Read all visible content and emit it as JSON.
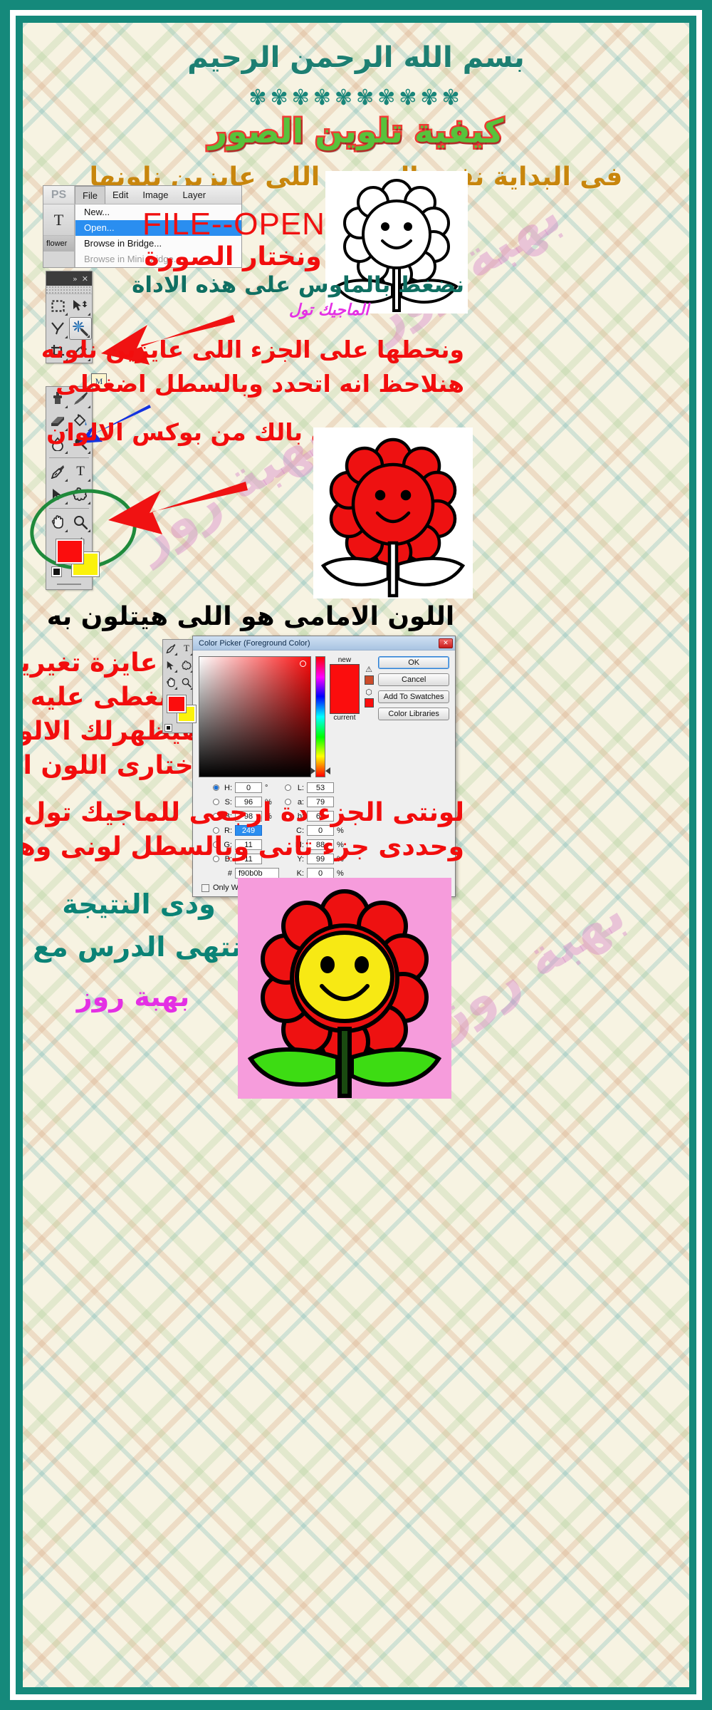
{
  "poster": {
    "frame_color": "#15897b",
    "background_note": "plaid fabric pattern",
    "watermark_text": "بهبة روز"
  },
  "header": {
    "basmala": "بسم الله الرحمن الرحيم",
    "stars": "✾✾✾✾✾✾✾✾✾✾",
    "title": "كيفية تلوين الصور",
    "title_colors": {
      "fill": "#8fe04e",
      "stroke": "#ef3b34"
    },
    "intro": "فى البداية نفتح الصورة اللى عايزين نلونها"
  },
  "photoshop_menu": {
    "app_logo": "PS",
    "menubar": [
      {
        "label": "File",
        "active": true
      },
      {
        "label": "Edit",
        "active": false
      },
      {
        "label": "Image",
        "active": false
      },
      {
        "label": "Layer",
        "active": false
      }
    ],
    "side_tool_letter": "T",
    "document_tab": "flower",
    "dropdown_items": [
      {
        "label": "New...",
        "selected": false,
        "dimmed": false
      },
      {
        "label": "Open...",
        "selected": true,
        "dimmed": false
      },
      {
        "label": "Browse in Bridge...",
        "selected": false,
        "dimmed": false
      },
      {
        "label": "Browse in Mini Bridge...",
        "selected": false,
        "dimmed": true
      }
    ]
  },
  "annotations": {
    "file_open_latin": "FILE--OPEN",
    "choose_image": "ونختار الصورة",
    "click_mouse_on_tool": "نضغط بالماوس على هذه الاداة",
    "magic_tool": "الماجيك تول",
    "click_part_to_color": "ونحطها على الجزء اللى عايزين نلونه",
    "note_bucket": "هنلاحظ انه اتحدد وبالسطل اضغطى",
    "pick_from_color_box": "نحدى بالك من بوكس الالوان",
    "foreground_color_note": "اللون الامامى هو اللى هيتلون به",
    "change_it": "لو عايزة تغيريه",
    "click_on_it": "اضغطى عليه",
    "colors_will_show": "هيظهرلك الالوان دى",
    "choose_color": "اختارى اللون اللى عيزاه",
    "after_color_back_to_magic": "لونتى الجزء دة ارجعى للماجيك تول",
    "select_next_part": "وحددى جزء تانى وبالسطل لونى وهكذا",
    "result": "ودى النتيجة",
    "lesson_end": "انتهى الدرس مع تحياتى",
    "signature": "بهبة روز"
  },
  "tool_panel": {
    "collapse_icon": "»",
    "close_icon": "✕",
    "tools": [
      {
        "name": "rectangular-marquee-tool",
        "glyph": "▭",
        "active": false
      },
      {
        "name": "move-tool",
        "glyph": "➤",
        "active": false
      },
      {
        "name": "lasso-tool",
        "glyph": "⌁",
        "active": false
      },
      {
        "name": "magic-wand-tool",
        "glyph": "✶",
        "active": true
      },
      {
        "name": "crop-tool",
        "glyph": "⌗",
        "active": false
      },
      {
        "name": "eyedropper-tool",
        "glyph": "⌖",
        "active": false
      },
      {
        "name": "clone-stamp-tool",
        "glyph": "⌸",
        "active": false
      },
      {
        "name": "brush-tool",
        "glyph": "✎",
        "active": false
      },
      {
        "name": "eraser-tool",
        "glyph": "▰",
        "active": false
      },
      {
        "name": "paint-bucket-tool",
        "glyph": "⬖",
        "active": false
      },
      {
        "name": "blur-tool",
        "glyph": "◗",
        "active": false
      },
      {
        "name": "dodge-tool",
        "glyph": "◉",
        "active": false
      },
      {
        "name": "pen-tool",
        "glyph": "✒",
        "active": false
      },
      {
        "name": "horizontal-type-tool",
        "glyph": "T",
        "active": false
      },
      {
        "name": "path-selection-tool",
        "glyph": "➤",
        "active": false
      },
      {
        "name": "custom-shape-tool",
        "glyph": "✿",
        "active": false
      },
      {
        "name": "hand-tool",
        "glyph": "✋",
        "active": false
      },
      {
        "name": "zoom-tool",
        "glyph": "⌕",
        "active": false
      }
    ],
    "foreground_color": "#fb0d0d",
    "background_color": "#fbf20b",
    "default_colors_icon": "default-colors-icon",
    "swap_colors_icon": "↰"
  },
  "color_picker": {
    "title": "Color Picker (Foreground Color)",
    "close_label": "✕",
    "label_new": "new",
    "label_current": "current",
    "new_color": "#fb0d0d",
    "current_color": "#fb0d0d",
    "gamut_warning_swatch": "#cc4b2a",
    "web_warning_swatch": "#fb0d0d",
    "buttons": [
      {
        "label": "OK",
        "primary": true
      },
      {
        "label": "Cancel",
        "primary": false
      },
      {
        "label": "Add To Swatches",
        "primary": false
      },
      {
        "label": "Color Libraries",
        "primary": false
      }
    ],
    "hsb": [
      {
        "label": "H:",
        "value": "0",
        "unit": "°",
        "selected_radio": true,
        "selected_field": false
      },
      {
        "label": "S:",
        "value": "96",
        "unit": "%",
        "selected_radio": false,
        "selected_field": false
      },
      {
        "label": "B:",
        "value": "98",
        "unit": "%",
        "selected_radio": false,
        "selected_field": false
      }
    ],
    "rgb": [
      {
        "label": "R:",
        "value": "249",
        "unit": "",
        "selected_radio": false,
        "selected_field": true
      },
      {
        "label": "G:",
        "value": "11",
        "unit": "",
        "selected_radio": false,
        "selected_field": false
      },
      {
        "label": "B:",
        "value": "11",
        "unit": "",
        "selected_radio": false,
        "selected_field": false
      }
    ],
    "lab": [
      {
        "label": "L:",
        "value": "53",
        "unit": "",
        "selected_radio": false,
        "selected_field": false
      },
      {
        "label": "a:",
        "value": "79",
        "unit": "",
        "selected_radio": false,
        "selected_field": false
      },
      {
        "label": "b:",
        "value": "66",
        "unit": "",
        "selected_radio": false,
        "selected_field": false
      }
    ],
    "cmyk": [
      {
        "label": "C:",
        "value": "0",
        "unit": "%"
      },
      {
        "label": "M:",
        "value": "88",
        "unit": "%"
      },
      {
        "label": "Y:",
        "value": "99",
        "unit": "%"
      },
      {
        "label": "K:",
        "value": "0",
        "unit": "%"
      }
    ],
    "hex_prefix": "#",
    "hex_value": "f90b0b",
    "only_web_colors_label": "Only Web Colors",
    "only_web_colors_checked": false
  },
  "flowers": [
    {
      "id": "flower-outline",
      "petal_color": "#ffffff",
      "center_color": "#ffffff",
      "leaf_color": "#ffffff",
      "stem_color": "#ffffff",
      "background": "#ffffff",
      "outline": "#000000"
    },
    {
      "id": "flower-red-petals",
      "petal_color": "#ee1111",
      "center_color": "#ffffff",
      "leaf_color": "#ffffff",
      "stem_color": "#ffffff",
      "background": "#ffffff",
      "outline": "#000000"
    },
    {
      "id": "flower-fully-colored",
      "petal_color": "#ee1111",
      "center_color": "#f7e914",
      "leaf_color": "#3ddc13",
      "stem_color": "#1a4a10",
      "background": "#f69cdc",
      "outline": "#000000"
    }
  ]
}
